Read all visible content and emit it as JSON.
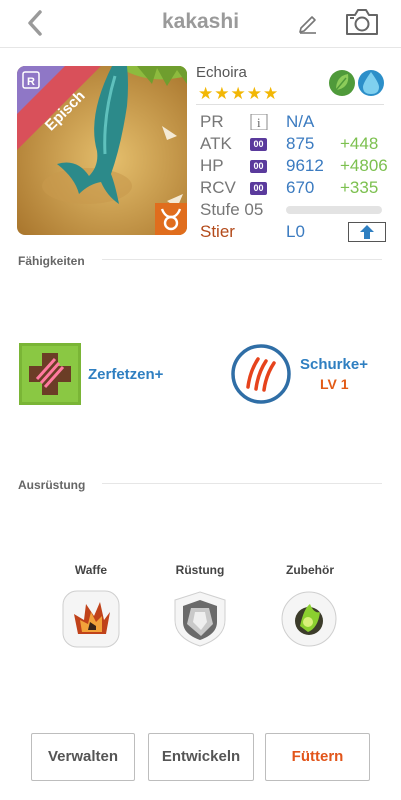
{
  "header": {
    "title": "kakashi",
    "back_icon": "chevron-left-icon",
    "edit_icon": "pencil-icon",
    "camera_icon": "camera-icon"
  },
  "portrait": {
    "rarity_ribbon": "Episch",
    "rarity_badge": "R",
    "zodiac_icon": "taurus-icon"
  },
  "monster": {
    "name": "Echoira",
    "stars": "★★★★★",
    "star_count": 5,
    "elements": [
      "leaf-icon",
      "water-drop-icon"
    ],
    "stats": {
      "pr": {
        "label": "PR",
        "value": "N/A"
      },
      "atk": {
        "label": "ATK",
        "badge": "00",
        "value": "875",
        "bonus": "+448"
      },
      "hp": {
        "label": "HP",
        "badge": "00",
        "value": "9612",
        "bonus": "+4806"
      },
      "rcv": {
        "label": "RCV",
        "badge": "00",
        "value": "670",
        "bonus": "+335"
      }
    },
    "level": {
      "label": "Stufe 05",
      "progress": 0.0
    },
    "sign": {
      "label": "Stier",
      "value": "L0"
    }
  },
  "skills": {
    "title": "Fähigkeiten",
    "active": {
      "name": "Zerfetzen+"
    },
    "leader": {
      "name": "Schurke+",
      "level": "LV 1"
    }
  },
  "equipment": {
    "title": "Ausrüstung",
    "slots": [
      {
        "label": "Waffe"
      },
      {
        "label": "Rüstung"
      },
      {
        "label": "Zubehör"
      }
    ]
  },
  "actions": {
    "manage": "Verwalten",
    "evolve": "Entwickeln",
    "feed": "Füttern"
  },
  "colors": {
    "ribbon": "#d9505a",
    "stars": "#f2b705",
    "stat_value": "#3b7bc0",
    "stat_bonus": "#7cc04f",
    "skill_text": "#2f7fc1",
    "accent": "#e2551a"
  }
}
